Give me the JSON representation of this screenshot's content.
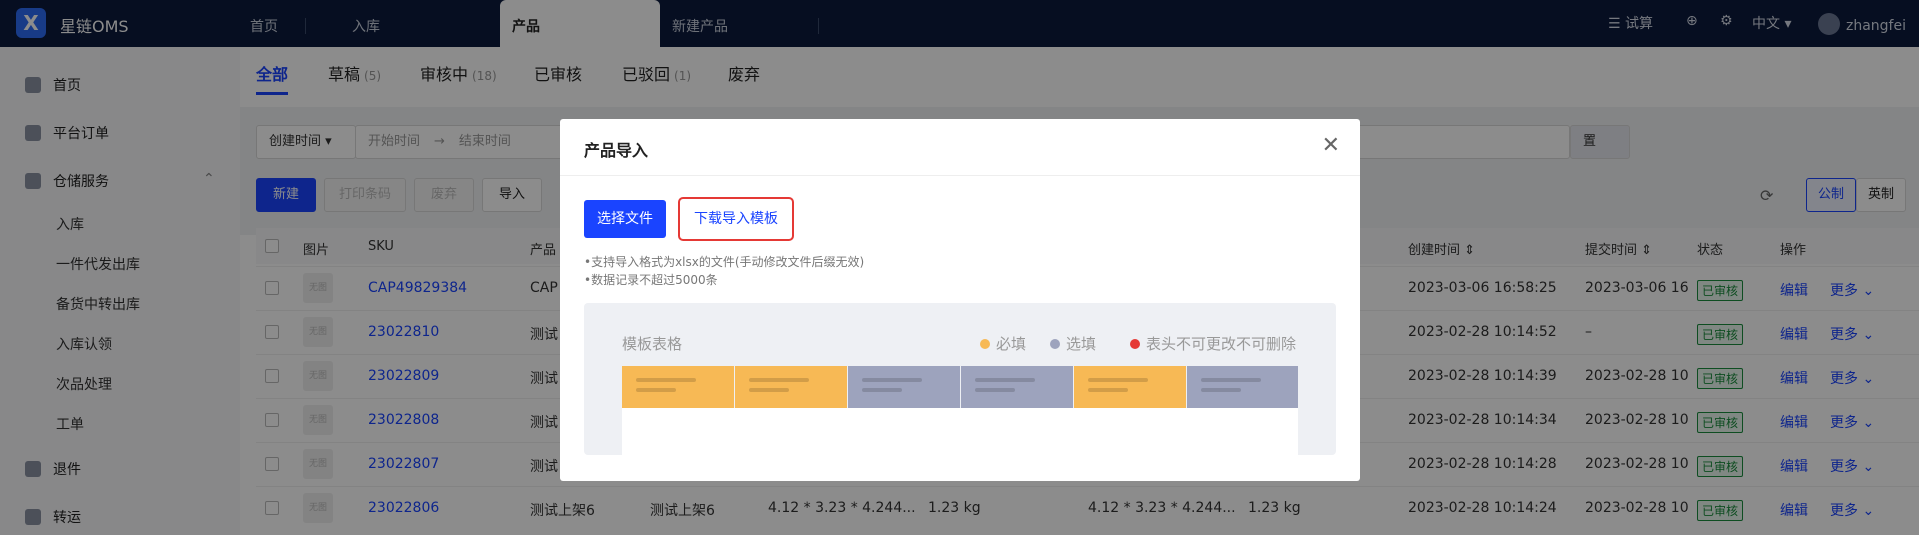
{
  "header": {
    "app_name": "星链OMS",
    "tabs": [
      "首页",
      "入库",
      "产品",
      "新建产品"
    ],
    "active_tab": "产品",
    "trial": "试算",
    "language": "中文",
    "username": "zhangfei"
  },
  "sidebar": {
    "items": [
      "首页",
      "平台订单",
      "仓储服务",
      "退件",
      "转运"
    ],
    "sub_items": [
      "入库",
      "一件代发出库",
      "备货中转出库",
      "入库认领",
      "次品处理",
      "工单"
    ]
  },
  "status_tabs": [
    {
      "label": "全部",
      "count": ""
    },
    {
      "label": "草稿",
      "count": "(5)"
    },
    {
      "label": "审核中",
      "count": "(18)"
    },
    {
      "label": "已审核",
      "count": ""
    },
    {
      "label": "已驳回",
      "count": "(1)"
    },
    {
      "label": "废弃",
      "count": ""
    }
  ],
  "filters": {
    "date_type": "创建时间",
    "start_placeholder": "开始时间",
    "end_placeholder": "结束时间",
    "reset": "置"
  },
  "toolbar": {
    "new": "新建",
    "print_barcode": "打印条码",
    "discard": "废弃",
    "import": "导入",
    "metric": "公制",
    "imperial": "英制"
  },
  "table": {
    "headers": [
      "图片",
      "SKU",
      "产品",
      "创建时间",
      "提交时间",
      "状态",
      "操作"
    ],
    "rows": [
      {
        "sku": "CAP49829384",
        "name": "CAP",
        "dims": "",
        "weight": "",
        "created": "2023-03-06 16:58:25",
        "submitted": "2023-03-06 16",
        "status": "已审核"
      },
      {
        "sku": "23022810",
        "name": "测试",
        "dims": "",
        "weight": "",
        "created": "2023-02-28 10:14:52",
        "submitted": "–",
        "status": "已审核"
      },
      {
        "sku": "23022809",
        "name": "测试",
        "dims": "",
        "weight": "",
        "created": "2023-02-28 10:14:39",
        "submitted": "2023-02-28 10",
        "status": "已审核"
      },
      {
        "sku": "23022808",
        "name": "测试",
        "dims": "",
        "weight": "",
        "created": "2023-02-28 10:14:34",
        "submitted": "2023-02-28 10",
        "status": "已审核"
      },
      {
        "sku": "23022807",
        "name": "测试",
        "dims": "",
        "weight": "",
        "created": "2023-02-28 10:14:28",
        "submitted": "2023-02-28 10",
        "status": "已审核"
      },
      {
        "sku": "23022806",
        "name": "测试上架6",
        "name2": "测试上架6",
        "dims": "4.12 * 3.23 * 4.244...",
        "weight": "1.23 kg",
        "created": "2023-02-28 10:14:24",
        "submitted": "2023-02-28 10",
        "status": "已审核"
      }
    ],
    "edit": "编辑",
    "more": "更多 ⌄",
    "img_placeholder": "无图"
  },
  "modal": {
    "title": "产品导入",
    "select_file": "选择文件",
    "download_template": "下载导入模板",
    "note1": "•支持导入格式为xlsx的文件(手动修改文件后缀无效)",
    "note2": "•数据记录不超过5000条",
    "preview_title": "模板表格",
    "legend_required": "必填",
    "legend_optional": "选填",
    "legend_fixed": "表头不可更改不可删除",
    "colors": {
      "required": "#f7b955",
      "optional": "#9da3bd",
      "fixed": "#e53935"
    }
  }
}
